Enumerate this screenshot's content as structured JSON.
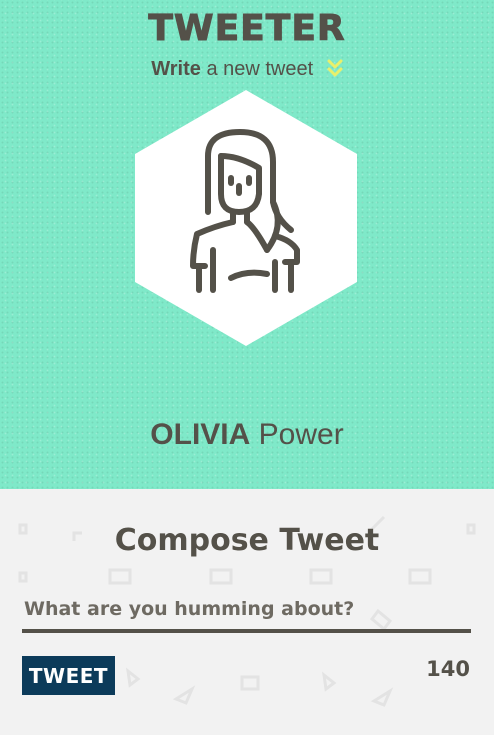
{
  "header": {
    "brand": "TWEETER",
    "tagline_bold": "Write",
    "tagline_rest": " a new tweet",
    "tagline_icon": "double-chevron-down-icon",
    "accent_color": "#7fe9c9",
    "chevron_color": "#e9f06b"
  },
  "profile": {
    "avatar_icon": "woman-avatar-icon",
    "first_name": "OLIVIA",
    "last_name": " Power"
  },
  "compose": {
    "title": "Compose Tweet",
    "placeholder": "What are you humming about?",
    "value": "",
    "button_label": "TWEET",
    "button_color": "#0c3b5a",
    "char_count": "140"
  }
}
